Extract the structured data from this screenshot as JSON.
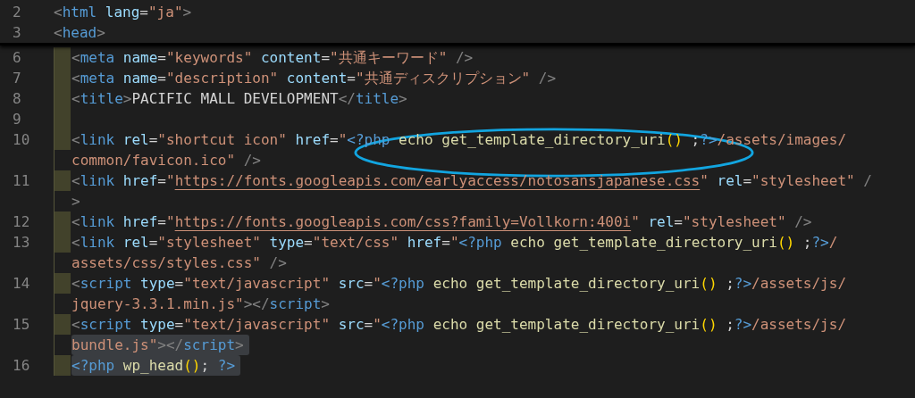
{
  "sticky_lines": [
    {
      "number": "2",
      "rows": [
        {
          "highlighted": false,
          "segments": [
            {
              "kind": "punct",
              "text": "<"
            },
            {
              "kind": "tag",
              "text": "html"
            },
            {
              "kind": "attr",
              "text": " lang"
            },
            {
              "kind": "plain",
              "text": "="
            },
            {
              "kind": "string",
              "text": "\"ja\""
            },
            {
              "kind": "punct",
              "text": ">"
            }
          ]
        }
      ]
    },
    {
      "number": "3",
      "rows": [
        {
          "highlighted": false,
          "segments": [
            {
              "kind": "punct",
              "text": "<"
            },
            {
              "kind": "tag",
              "text": "head"
            },
            {
              "kind": "punct",
              "text": ">"
            }
          ]
        }
      ]
    }
  ],
  "lines": [
    {
      "number": "6",
      "rows": [
        {
          "highlighted": false,
          "segments": [
            {
              "kind": "punct",
              "text": "<"
            },
            {
              "kind": "tag",
              "text": "meta"
            },
            {
              "kind": "attr",
              "text": " name"
            },
            {
              "kind": "plain",
              "text": "="
            },
            {
              "kind": "string",
              "text": "\"keywords\""
            },
            {
              "kind": "attr",
              "text": " content"
            },
            {
              "kind": "plain",
              "text": "="
            },
            {
              "kind": "string",
              "text": "\"共通キーワード\""
            },
            {
              "kind": "punct",
              "text": " />"
            }
          ]
        }
      ]
    },
    {
      "number": "7",
      "rows": [
        {
          "highlighted": false,
          "segments": [
            {
              "kind": "punct",
              "text": "<"
            },
            {
              "kind": "tag",
              "text": "meta"
            },
            {
              "kind": "attr",
              "text": " name"
            },
            {
              "kind": "plain",
              "text": "="
            },
            {
              "kind": "string",
              "text": "\"description\""
            },
            {
              "kind": "attr",
              "text": " content"
            },
            {
              "kind": "plain",
              "text": "="
            },
            {
              "kind": "string",
              "text": "\"共通ディスクリプション\""
            },
            {
              "kind": "punct",
              "text": " />"
            }
          ]
        }
      ]
    },
    {
      "number": "8",
      "rows": [
        {
          "highlighted": false,
          "segments": [
            {
              "kind": "punct",
              "text": "<"
            },
            {
              "kind": "tag",
              "text": "title"
            },
            {
              "kind": "punct",
              "text": ">"
            },
            {
              "kind": "plain",
              "text": "PACIFIC MALL DEVELOPMENT"
            },
            {
              "kind": "punct",
              "text": "</"
            },
            {
              "kind": "tag",
              "text": "title"
            },
            {
              "kind": "punct",
              "text": ">"
            }
          ]
        }
      ]
    },
    {
      "number": "9",
      "rows": [
        {
          "highlighted": false,
          "segments": []
        }
      ]
    },
    {
      "number": "10",
      "rows": [
        {
          "highlighted": false,
          "segments": [
            {
              "kind": "punct",
              "text": "<"
            },
            {
              "kind": "tag",
              "text": "link"
            },
            {
              "kind": "attr",
              "text": " rel"
            },
            {
              "kind": "plain",
              "text": "="
            },
            {
              "kind": "string",
              "text": "\"shortcut icon\""
            },
            {
              "kind": "attr",
              "text": " href"
            },
            {
              "kind": "plain",
              "text": "="
            },
            {
              "kind": "string",
              "text": "\""
            },
            {
              "kind": "php",
              "text": "<?php"
            },
            {
              "kind": "func",
              "text": " echo get_template_directory_uri"
            },
            {
              "kind": "paren",
              "text": "()"
            },
            {
              "kind": "plain",
              "text": " ;"
            },
            {
              "kind": "php",
              "text": "?>"
            },
            {
              "kind": "string",
              "text": "/assets/images/"
            }
          ]
        },
        {
          "highlighted": false,
          "segments": [
            {
              "kind": "string",
              "text": "common/favicon.ico\""
            },
            {
              "kind": "punct",
              "text": " />"
            }
          ]
        }
      ]
    },
    {
      "number": "11",
      "rows": [
        {
          "highlighted": false,
          "segments": [
            {
              "kind": "punct",
              "text": "<"
            },
            {
              "kind": "tag",
              "text": "link"
            },
            {
              "kind": "attr",
              "text": " href"
            },
            {
              "kind": "plain",
              "text": "="
            },
            {
              "kind": "string",
              "text": "\""
            },
            {
              "kind": "link",
              "text": "https://fonts.googleapis.com/earlyaccess/notosansjapanese.css"
            },
            {
              "kind": "string",
              "text": "\""
            },
            {
              "kind": "attr",
              "text": " rel"
            },
            {
              "kind": "plain",
              "text": "="
            },
            {
              "kind": "string",
              "text": "\"stylesheet\""
            },
            {
              "kind": "punct",
              "text": " /"
            }
          ]
        },
        {
          "highlighted": false,
          "segments": [
            {
              "kind": "punct",
              "text": ">"
            }
          ]
        }
      ]
    },
    {
      "number": "12",
      "rows": [
        {
          "highlighted": false,
          "segments": [
            {
              "kind": "punct",
              "text": "<"
            },
            {
              "kind": "tag",
              "text": "link"
            },
            {
              "kind": "attr",
              "text": " href"
            },
            {
              "kind": "plain",
              "text": "="
            },
            {
              "kind": "string",
              "text": "\""
            },
            {
              "kind": "link",
              "text": "https://fonts.googleapis.com/css?family=Vollkorn:400i"
            },
            {
              "kind": "string",
              "text": "\""
            },
            {
              "kind": "attr",
              "text": " rel"
            },
            {
              "kind": "plain",
              "text": "="
            },
            {
              "kind": "string",
              "text": "\"stylesheet\""
            },
            {
              "kind": "punct",
              "text": " />"
            }
          ]
        }
      ]
    },
    {
      "number": "13",
      "rows": [
        {
          "highlighted": false,
          "segments": [
            {
              "kind": "punct",
              "text": "<"
            },
            {
              "kind": "tag",
              "text": "link"
            },
            {
              "kind": "attr",
              "text": " rel"
            },
            {
              "kind": "plain",
              "text": "="
            },
            {
              "kind": "string",
              "text": "\"stylesheet\""
            },
            {
              "kind": "attr",
              "text": " type"
            },
            {
              "kind": "plain",
              "text": "="
            },
            {
              "kind": "string",
              "text": "\"text/css\""
            },
            {
              "kind": "attr",
              "text": " href"
            },
            {
              "kind": "plain",
              "text": "="
            },
            {
              "kind": "string",
              "text": "\""
            },
            {
              "kind": "php",
              "text": "<?php"
            },
            {
              "kind": "func",
              "text": " echo get_template_directory_uri"
            },
            {
              "kind": "paren",
              "text": "()"
            },
            {
              "kind": "plain",
              "text": " ;"
            },
            {
              "kind": "php",
              "text": "?>"
            },
            {
              "kind": "string",
              "text": "/"
            }
          ]
        },
        {
          "highlighted": false,
          "segments": [
            {
              "kind": "string",
              "text": "assets/css/styles.css\""
            },
            {
              "kind": "punct",
              "text": " />"
            }
          ]
        }
      ]
    },
    {
      "number": "14",
      "rows": [
        {
          "highlighted": false,
          "segments": [
            {
              "kind": "punct",
              "text": "<"
            },
            {
              "kind": "tag",
              "text": "script"
            },
            {
              "kind": "attr",
              "text": " type"
            },
            {
              "kind": "plain",
              "text": "="
            },
            {
              "kind": "string",
              "text": "\"text/javascript\""
            },
            {
              "kind": "attr",
              "text": " src"
            },
            {
              "kind": "plain",
              "text": "="
            },
            {
              "kind": "string",
              "text": "\""
            },
            {
              "kind": "php",
              "text": "<?php"
            },
            {
              "kind": "func",
              "text": " echo get_template_directory_uri"
            },
            {
              "kind": "paren",
              "text": "()"
            },
            {
              "kind": "plain",
              "text": " ;"
            },
            {
              "kind": "php",
              "text": "?>"
            },
            {
              "kind": "string",
              "text": "/assets/js/"
            }
          ]
        },
        {
          "highlighted": false,
          "segments": [
            {
              "kind": "string",
              "text": "jquery-3.3.1.min.js\""
            },
            {
              "kind": "punct",
              "text": "></"
            },
            {
              "kind": "tag",
              "text": "script"
            },
            {
              "kind": "punct",
              "text": ">"
            }
          ]
        }
      ]
    },
    {
      "number": "15",
      "rows": [
        {
          "highlighted": false,
          "segments": [
            {
              "kind": "punct",
              "text": "<"
            },
            {
              "kind": "tag",
              "text": "script"
            },
            {
              "kind": "attr",
              "text": " type"
            },
            {
              "kind": "plain",
              "text": "="
            },
            {
              "kind": "string",
              "text": "\"text/javascript\""
            },
            {
              "kind": "attr",
              "text": " src"
            },
            {
              "kind": "plain",
              "text": "="
            },
            {
              "kind": "string",
              "text": "\""
            },
            {
              "kind": "php",
              "text": "<?php"
            },
            {
              "kind": "func",
              "text": " echo get_template_directory_uri"
            },
            {
              "kind": "paren",
              "text": "()"
            },
            {
              "kind": "plain",
              "text": " ;"
            },
            {
              "kind": "php",
              "text": "?>"
            },
            {
              "kind": "string",
              "text": "/assets/js/"
            }
          ]
        },
        {
          "highlighted": true,
          "segments": [
            {
              "kind": "string",
              "text": "bundle.js\""
            },
            {
              "kind": "punct",
              "text": "></"
            },
            {
              "kind": "tag",
              "text": "script"
            },
            {
              "kind": "punct",
              "text": ">"
            }
          ]
        }
      ]
    },
    {
      "number": "16",
      "rows": [
        {
          "highlighted": true,
          "segments": [
            {
              "kind": "php",
              "text": "<?php"
            },
            {
              "kind": "func",
              "text": " wp_head"
            },
            {
              "kind": "paren",
              "text": "()"
            },
            {
              "kind": "plain",
              "text": ";"
            },
            {
              "kind": "php",
              "text": " ?>"
            }
          ]
        }
      ]
    }
  ]
}
